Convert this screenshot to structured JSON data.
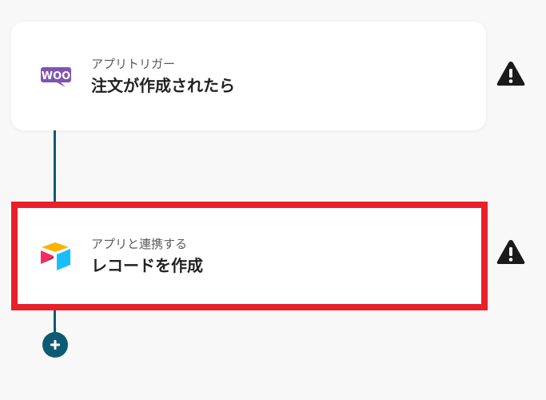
{
  "steps": [
    {
      "app_icon": "woocommerce-icon",
      "subtitle": "アプリトリガー",
      "title": "注文が作成されたら",
      "status_icon": "warning-icon"
    },
    {
      "app_icon": "airtable-icon",
      "subtitle": "アプリと連携する",
      "title": "レコードを作成",
      "status_icon": "warning-icon",
      "selected": true
    }
  ],
  "add_button_icon": "plus-icon",
  "colors": {
    "connector": "#0d5b73",
    "selection_border": "#e8202a",
    "woocommerce": "#7f54b3",
    "warning": "#1a1a1a"
  }
}
